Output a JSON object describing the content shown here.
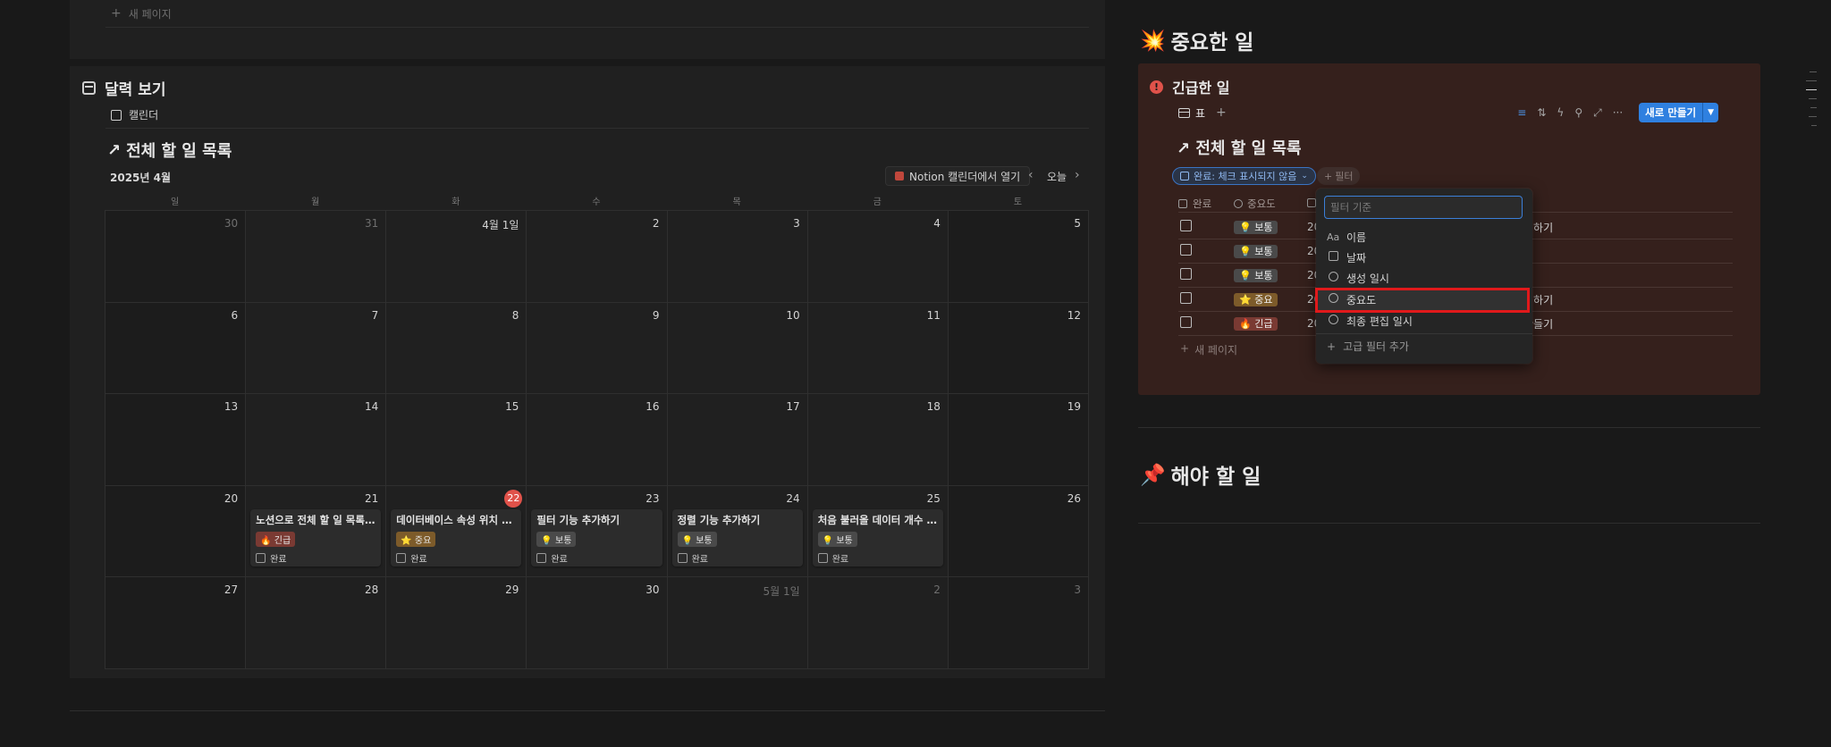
{
  "top_section": {
    "new_page_label": "새 페이지"
  },
  "calendar_section": {
    "heading": "달력 보기",
    "view_tab": "캘린더",
    "linked_title": "전체 할 일 목록",
    "month_label": "2025년 4월",
    "open_in_notion": "Notion 캘린더에서 열기",
    "today": "오늘",
    "weekdays": [
      "일",
      "월",
      "화",
      "수",
      "목",
      "금",
      "토"
    ],
    "weeks": [
      [
        {
          "d": "30",
          "dim": true
        },
        {
          "d": "31",
          "dim": true
        },
        {
          "d": "4월 1일"
        },
        {
          "d": "2"
        },
        {
          "d": "3"
        },
        {
          "d": "4"
        },
        {
          "d": "5"
        }
      ],
      [
        {
          "d": "6"
        },
        {
          "d": "7"
        },
        {
          "d": "8"
        },
        {
          "d": "9"
        },
        {
          "d": "10"
        },
        {
          "d": "11"
        },
        {
          "d": "12"
        }
      ],
      [
        {
          "d": "13"
        },
        {
          "d": "14"
        },
        {
          "d": "15"
        },
        {
          "d": "16"
        },
        {
          "d": "17"
        },
        {
          "d": "18"
        },
        {
          "d": "19"
        }
      ],
      [
        {
          "d": "20"
        },
        {
          "d": "21"
        },
        {
          "d": "22",
          "today": true
        },
        {
          "d": "23"
        },
        {
          "d": "24"
        },
        {
          "d": "25"
        },
        {
          "d": "26"
        }
      ],
      [
        {
          "d": "27"
        },
        {
          "d": "28"
        },
        {
          "d": "29"
        },
        {
          "d": "30"
        },
        {
          "d": "5월 1일",
          "dim": true
        },
        {
          "d": "2",
          "dim": true
        },
        {
          "d": "3",
          "dim": true
        }
      ]
    ],
    "events": [
      {
        "week": 3,
        "day": 1,
        "title": "노션으로 전체 할 일 목록 만...",
        "tag": "🔥 긴급",
        "tag_type": "urgent",
        "done_label": "완료"
      },
      {
        "week": 3,
        "day": 2,
        "title": "데이터베이스 속성 위치 변...",
        "tag": "⭐ 중요",
        "tag_type": "important",
        "done_label": "완료"
      },
      {
        "week": 3,
        "day": 3,
        "title": "필터 기능 추가하기",
        "tag": "💡 보통",
        "tag_type": "normal",
        "done_label": "완료"
      },
      {
        "week": 3,
        "day": 4,
        "title": "정렬 기능 추가하기",
        "tag": "💡 보통",
        "tag_type": "normal",
        "done_label": "완료"
      },
      {
        "week": 3,
        "day": 5,
        "title": "처음 불러올 데이터 개수 지...",
        "tag": "💡 보통",
        "tag_type": "normal",
        "done_label": "완료"
      }
    ]
  },
  "important_section": {
    "emoji": "💥",
    "title": "중요한 일",
    "urgent_box": {
      "heading": "긴급한 일",
      "view_tab": "표",
      "new_button": "새로 만들기",
      "linked_title": "전체 할 일 목록",
      "filter_chip": "완료: 체크 표시되지 않음",
      "add_filter": "필터",
      "columns": [
        "완료",
        "중요도"
      ],
      "rows": [
        {
          "tag": "💡 보통",
          "tag_type": "normal",
          "date": "20",
          "title_tail": "정하기"
        },
        {
          "tag": "💡 보통",
          "tag_type": "normal",
          "date": "20",
          "title_tail": ""
        },
        {
          "tag": "💡 보통",
          "tag_type": "normal",
          "date": "20",
          "title_tail": ""
        },
        {
          "tag": "⭐ 중요",
          "tag_type": "important",
          "date": "20",
          "title_tail": "경하기"
        },
        {
          "tag": "🔥 긴급",
          "tag_type": "urgent",
          "date": "20",
          "title_tail": "만들기"
        }
      ],
      "new_page_label": "새 페이지"
    },
    "filter_dropdown": {
      "placeholder": "필터 기준",
      "items": [
        {
          "icon": "Aa",
          "label": "이름"
        },
        {
          "icon": "calendar-icon",
          "label": "날짜"
        },
        {
          "icon": "clock-icon",
          "label": "생성 일시"
        },
        {
          "icon": "select-icon",
          "label": "중요도"
        },
        {
          "icon": "clock-icon",
          "label": "최종 편집 일시"
        }
      ],
      "advanced": "고급 필터 추가"
    }
  },
  "todo_section": {
    "emoji": "📌",
    "title": "해야 할 일"
  },
  "colors": {
    "accent": "#2f80e0",
    "highlight": "#e0191b",
    "urgent_bg": "#35201c",
    "today": "#e0524a"
  }
}
